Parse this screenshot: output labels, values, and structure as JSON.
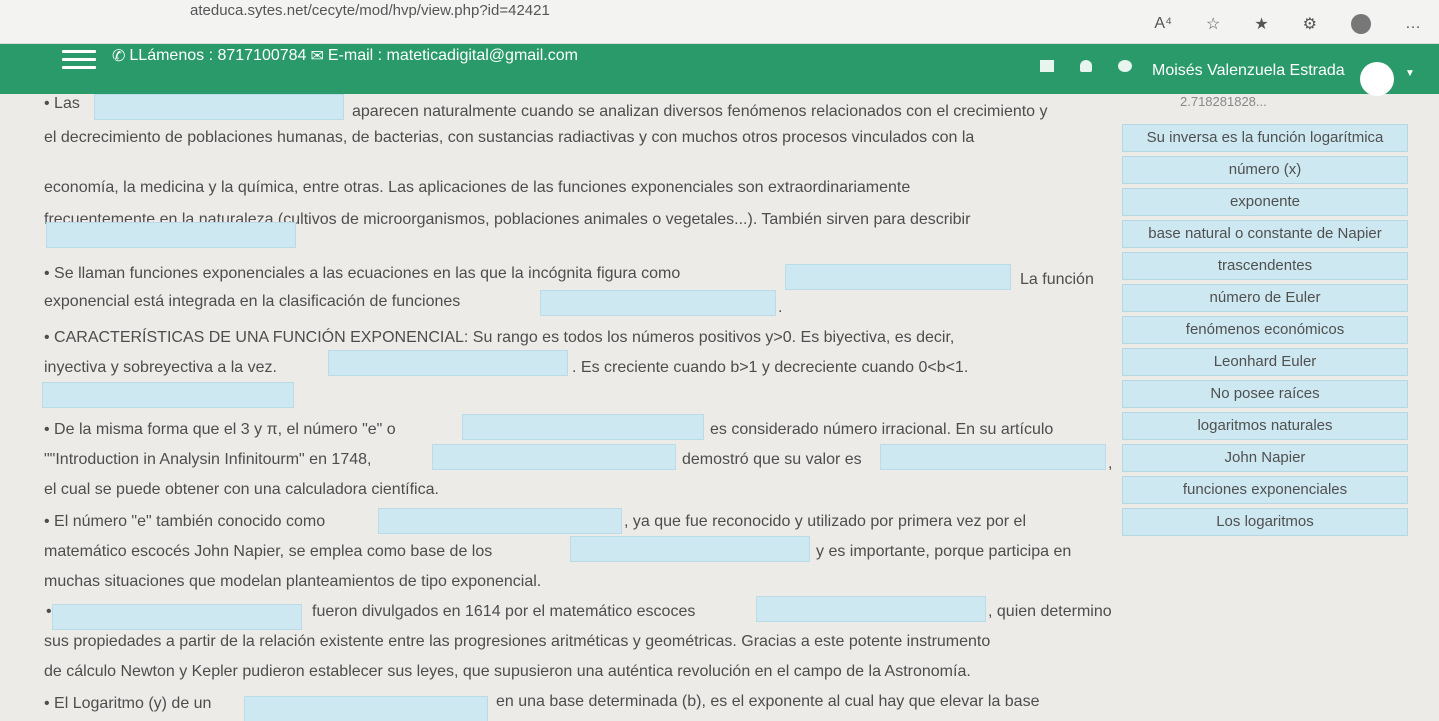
{
  "browser": {
    "url": "ateduca.sytes.net/cecyte/mod/hvp/view.php?id=42421",
    "icons": [
      "read-aloud-icon",
      "favorite-icon",
      "favorites-bar-icon",
      "extensions-icon",
      "profile-icon",
      "more-icon"
    ],
    "icon_glyphs": [
      "A⁴",
      "☆",
      "★",
      "⚙",
      "",
      "…"
    ]
  },
  "header": {
    "contact_phone": "LLámenos : 8717100784",
    "contact_email": "E-mail : mateticadigital@gmail.com",
    "user_name": "Moisés Valenzuela Estrada"
  },
  "content": {
    "lines": [
      "• Las",
      "aparecen naturalmente cuando se analizan diversos fenómenos relacionados con el crecimiento y",
      "el decrecimiento de poblaciones humanas, de bacterias, con sustancias radiactivas y con muchos otros procesos vinculados con la",
      "economía, la medicina y la química, entre otras. Las aplicaciones de las funciones exponenciales son extraordinariamente",
      "frecuentemente en la naturaleza (cultivos de microorganismos, poblaciones animales o vegetales...). También sirven para describir",
      "• Se llaman funciones exponenciales a las ecuaciones en las que la incógnita figura como",
      "La función",
      "exponencial está integrada en la clasificación de funciones",
      ".",
      "• CARACTERÍSTICAS DE UNA FUNCIÓN EXPONENCIAL: Su rango es todos los números positivos y>0. Es biyectiva, es decir,",
      "inyectiva y sobreyectiva a la vez.",
      ". Es creciente cuando b>1 y decreciente cuando 0<b<1.",
      "• De la misma forma que el 3 y π, el número \"e\" o",
      "es considerado número irracional. En su artículo",
      "\"\"Introduction in Analysin Infinitourm\" en 1748,",
      "demostró que su valor es",
      ",",
      "el cual se puede obtener con una calculadora científica.",
      "• El número \"e\" también conocido como",
      ", ya que fue reconocido y utilizado por primera vez por el",
      "matemático escocés John Napier, se emplea como base de los",
      "y es importante, porque participa en",
      "muchas situaciones que modelan planteamientos de tipo exponencial.",
      "•",
      "fueron divulgados en 1614 por el matemático escoces",
      ", quien determino",
      "sus propiedades a partir de la relación existente entre las progresiones aritméticas y geométricas. Gracias a este potente instrumento",
      "de cálculo Newton y Kepler pudieron establecer sus leyes, que supusieron una auténtica revolución en el campo de la Astronomía.",
      "• El Logaritmo (y) de un",
      "en una base determinada (b), es el exponente al cual hay que elevar la base"
    ]
  },
  "word_bank": {
    "cut_off_text": "2.718281828...",
    "options": [
      "Su inversa es la función logarítmica",
      "número (x)",
      "exponente",
      "base natural o constante de Napier",
      "trascendentes",
      "número de Euler",
      "fenómenos económicos",
      "Leonhard Euler",
      "No posee raíces",
      "logaritmos naturales",
      "John Napier",
      "funciones exponenciales",
      "Los logaritmos"
    ]
  }
}
